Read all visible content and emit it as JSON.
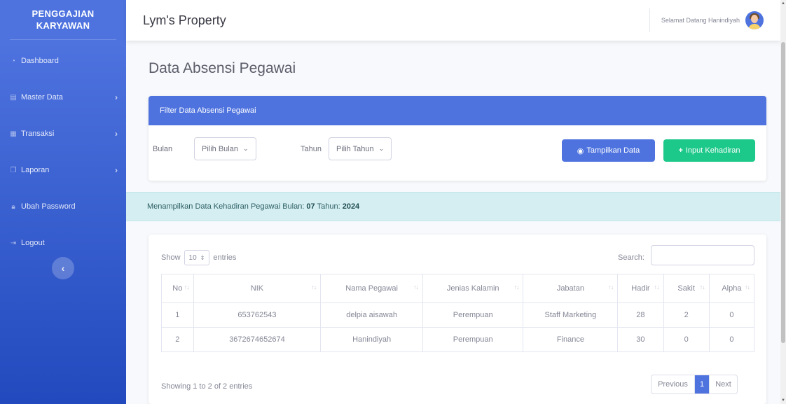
{
  "sidebar": {
    "brand_line1": "PENGGAJIAN",
    "brand_line2": "KARYAWAN",
    "items": [
      {
        "label": "Dashboard",
        "icon": "dashboard-icon"
      },
      {
        "label": "Master Data",
        "icon": "database-icon"
      },
      {
        "label": "Transaksi",
        "icon": "table-icon"
      },
      {
        "label": "Laporan",
        "icon": "copy-icon"
      },
      {
        "label": "Ubah Password",
        "icon": "lock-icon"
      },
      {
        "label": "Logout",
        "icon": "sign-out-icon"
      }
    ]
  },
  "topbar": {
    "title": "Lym's Property",
    "greeting": "Selamat Datang Hanindiyah"
  },
  "page": {
    "title": "Data Absensi Pegawai"
  },
  "filter": {
    "header": "Filter Data Absensi Pegawai",
    "bulan_label": "Bulan",
    "bulan_value": "Pilih Bulan",
    "tahun_label": "Tahun",
    "tahun_value": "Pilih Tahun",
    "show_button": "Tampilkan Data",
    "input_button": "Input Kehadiran"
  },
  "alert": {
    "prefix": "Menampilkan Data Kehadiran Pegawai Bulan:",
    "month": "07",
    "year_label": "Tahun:",
    "year": "2024"
  },
  "table": {
    "show_label": "Show",
    "entries_value": "10",
    "entries_label": "entries",
    "search_label": "Search:",
    "search_value": "",
    "columns": [
      "No",
      "NIK",
      "Nama Pegawai",
      "Jenias Kalamin",
      "Jabatan",
      "Hadir",
      "Sakit",
      "Alpha"
    ],
    "rows": [
      [
        "1",
        "653762543",
        "delpia aisawah",
        "Perempuan",
        "Staff Marketing",
        "28",
        "2",
        "0"
      ],
      [
        "2",
        "3672674652674",
        "Hanindiyah",
        "Perempuan",
        "Finance",
        "30",
        "0",
        "0"
      ]
    ],
    "info": "Showing 1 to 2 of 2 entries",
    "pagination": {
      "previous": "Previous",
      "current": "1",
      "next": "Next"
    }
  },
  "colors": {
    "primary": "#4e73df",
    "success": "#1cc88a",
    "info_bg": "#d4eef1"
  }
}
